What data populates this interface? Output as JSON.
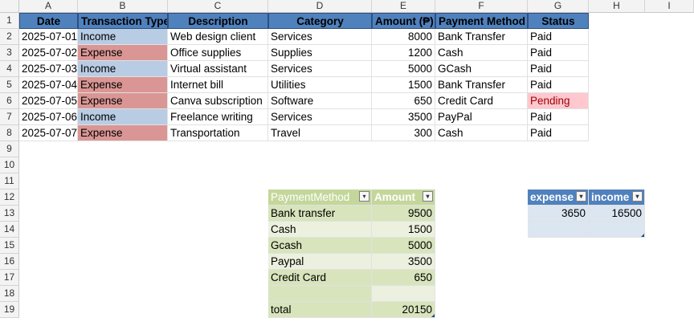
{
  "columns": [
    "A",
    "B",
    "C",
    "D",
    "E",
    "F",
    "G",
    "H",
    "I"
  ],
  "rows": [
    "1",
    "2",
    "3",
    "4",
    "5",
    "6",
    "7",
    "8",
    "9",
    "10",
    "11",
    "12",
    "13",
    "14",
    "15",
    "16",
    "17",
    "18",
    "19"
  ],
  "headers": {
    "date": "Date",
    "type": "Transaction Type",
    "description": "Description",
    "category": "Category",
    "amount": "Amount (₱)",
    "method": "Payment Method",
    "status": "Status"
  },
  "transactions": [
    {
      "date": "2025-07-01",
      "type": "Income",
      "description": "Web design client",
      "category": "Services",
      "amount": "8000",
      "method": "Bank Transfer",
      "status": "Paid"
    },
    {
      "date": "2025-07-02",
      "type": "Expense",
      "description": "Office supplies",
      "category": "Supplies",
      "amount": "1200",
      "method": "Cash",
      "status": "Paid"
    },
    {
      "date": "2025-07-03",
      "type": "Income",
      "description": "Virtual assistant",
      "category": "Services",
      "amount": "5000",
      "method": "GCash",
      "status": "Paid"
    },
    {
      "date": "2025-07-04",
      "type": "Expense",
      "description": "Internet bill",
      "category": "Utilities",
      "amount": "1500",
      "method": "Bank Transfer",
      "status": "Paid"
    },
    {
      "date": "2025-07-05",
      "type": "Expense",
      "description": "Canva subscription",
      "category": "Software",
      "amount": "650",
      "method": "Credit Card",
      "status": "Pending"
    },
    {
      "date": "2025-07-06",
      "type": "Income",
      "description": "Freelance writing",
      "category": "Services",
      "amount": "3500",
      "method": "PayPal",
      "status": "Paid"
    },
    {
      "date": "2025-07-07",
      "type": "Expense",
      "description": "Transportation",
      "category": "Travel",
      "amount": "300",
      "method": "Cash",
      "status": "Paid"
    }
  ],
  "payment_table": {
    "header_method": "PaymentMethod",
    "header_amount": "Amount",
    "rows": [
      {
        "method": "Bank transfer",
        "amount": "9500"
      },
      {
        "method": "Cash",
        "amount": "1500"
      },
      {
        "method": "Gcash",
        "amount": "5000"
      },
      {
        "method": "Paypal",
        "amount": "3500"
      },
      {
        "method": "Credit Card",
        "amount": "650"
      }
    ],
    "total_label": "total",
    "total_value": "20150"
  },
  "summary_table": {
    "header_expense": "expense",
    "header_income": "income",
    "expense": "3650",
    "income": "16500"
  },
  "filter_icon": "▾",
  "colors": {
    "header_blue": "#4f81bd",
    "income_fill": "#b8cce4",
    "expense_fill": "#da9694",
    "pending_fill": "#ffc7ce",
    "green_header": "#c4d79b"
  }
}
